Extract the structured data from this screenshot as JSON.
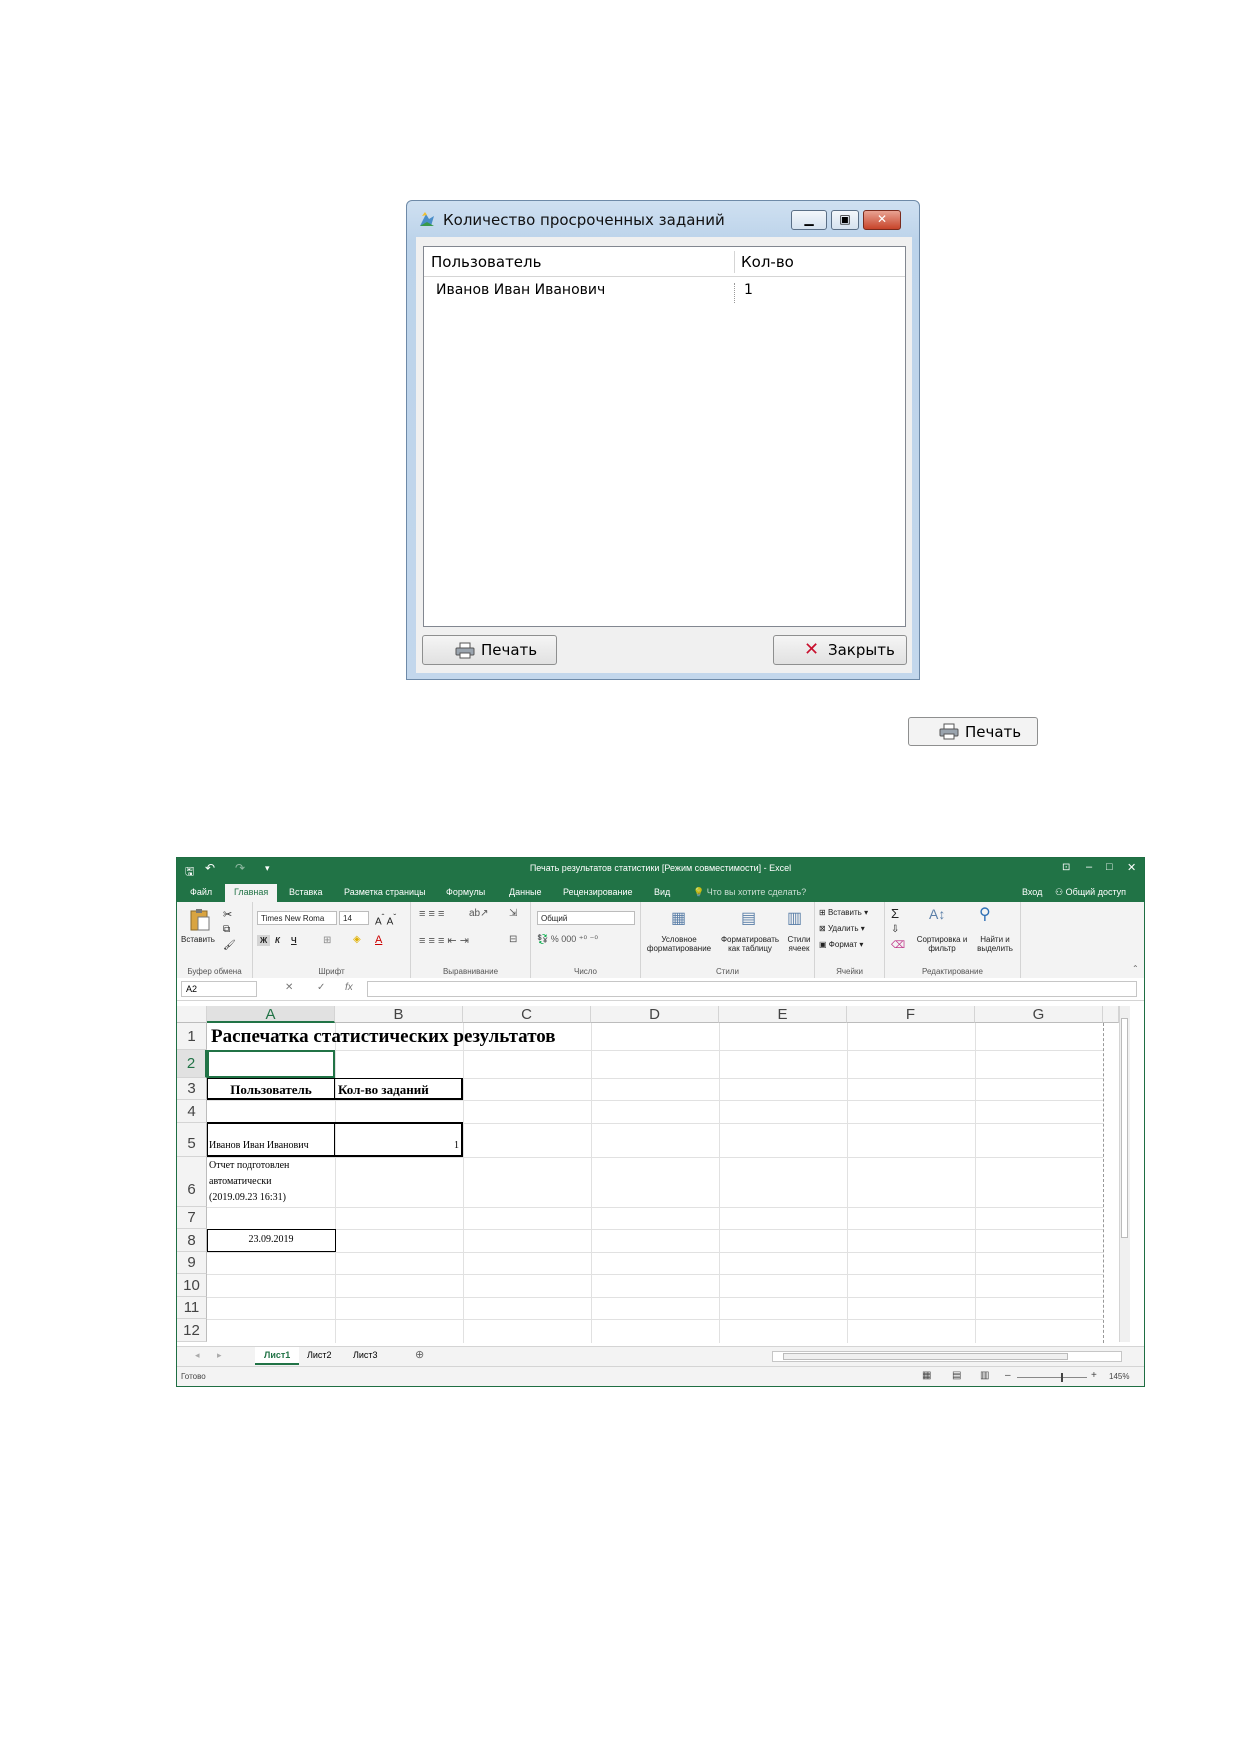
{
  "dialog": {
    "title": "Количество просроченных заданий",
    "columns": [
      "Пользователь",
      "Кол-во"
    ],
    "rows": [
      {
        "user": "Иванов Иван Иванович",
        "count": "1"
      }
    ],
    "print_label": "Печать",
    "close_label": "Закрыть"
  },
  "standalone_print_label": "Печать",
  "excel": {
    "title": "Печать результатов статистики  [Режим совместимости] - Excel",
    "ribbon_tabs": [
      "Файл",
      "Главная",
      "Вставка",
      "Разметка страницы",
      "Формулы",
      "Данные",
      "Рецензирование",
      "Вид"
    ],
    "active_tab": "Главная",
    "tell_me": "Что вы хотите сделать?",
    "signin": "Вход",
    "share": "Общий доступ",
    "ribbon": {
      "clipboard": {
        "paste": "Вставить",
        "group": "Буфер обмена"
      },
      "font": {
        "name": "Times New Roma",
        "size": "14",
        "group": "Шрифт",
        "bold": "Ж",
        "italic": "К",
        "underline": "Ч"
      },
      "alignment": {
        "group": "Выравнивание"
      },
      "number": {
        "format": "Общий",
        "group": "Число"
      },
      "styles": {
        "conditional": "Условное форматирование",
        "as_table": "Форматировать как таблицу",
        "cell_styles": "Стили ячеек",
        "group": "Стили"
      },
      "cells": {
        "insert": "Вставить",
        "delete": "Удалить",
        "format": "Формат",
        "group": "Ячейки"
      },
      "editing": {
        "sort": "Сортировка и фильтр",
        "find": "Найти и выделить",
        "group": "Редактирование"
      }
    },
    "name_box": "A2",
    "fx_symbol": "fx",
    "columns": [
      "A",
      "B",
      "C",
      "D",
      "E",
      "F",
      "G"
    ],
    "rows": [
      "1",
      "2",
      "3",
      "4",
      "5",
      "6",
      "7",
      "8",
      "9",
      "10",
      "11",
      "12"
    ],
    "cells": {
      "A1": "Распечатка статистических результатов",
      "A3": "Пользователь",
      "B3": "Кол-во заданий",
      "A5": "Иванов Иван Иванович",
      "B5": "1",
      "A6_line1": "Отчет подготовлен",
      "A6_line2": "автоматически",
      "A6_line3": "(2019.09.23 16:31)",
      "A8": "23.09.2019"
    },
    "sheets": [
      "Лист1",
      "Лист2",
      "Лист3"
    ],
    "active_sheet": "Лист1",
    "status": "Готово",
    "zoom": "145%",
    "accent": "#217346"
  }
}
